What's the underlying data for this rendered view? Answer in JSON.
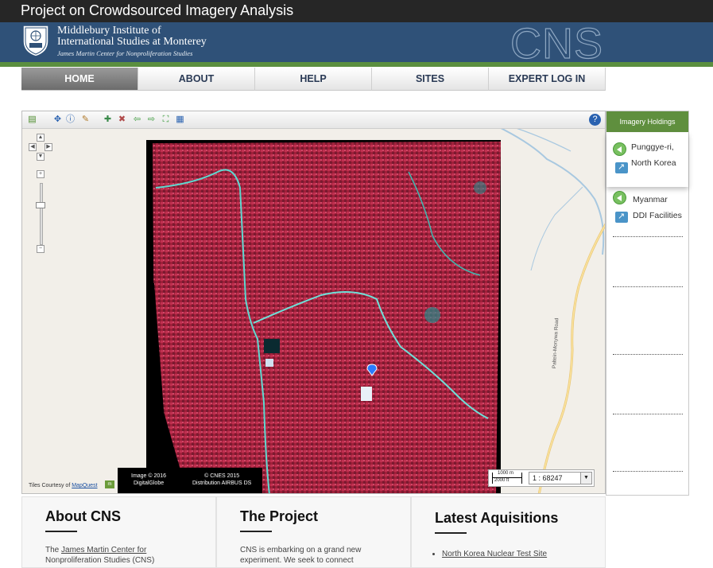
{
  "site_title": "Project on Crowdsourced Imagery Analysis",
  "header": {
    "institute_line1": "Middlebury Institute of",
    "institute_line2": "International Studies at Monterey",
    "institute_line3": "James Martin Center for Nonproliferation Studies",
    "logo_text": "CNS"
  },
  "nav": {
    "items": [
      {
        "label": "HOME",
        "active": true
      },
      {
        "label": "ABOUT",
        "active": false
      },
      {
        "label": "HELP",
        "active": false
      },
      {
        "label": "SITES",
        "active": false
      },
      {
        "label": "EXPERT LOG IN",
        "active": false
      }
    ]
  },
  "map": {
    "tiles_credit": "Tiles Courtesy of",
    "tiles_provider": "MapQuest",
    "image_credit_1": "Image © 2016",
    "image_credit_2": "DigitalGlobe",
    "image_credit_3": "© CNES 2015",
    "image_credit_4": "Distribution AIRBUS DS",
    "scale_m": "1000 m",
    "scale_ft": "2000 ft",
    "scale_value": "1 : 68247",
    "road_label": "Paltein-Monywa Road"
  },
  "side_panel": {
    "title": "Imagery Holdings",
    "holdings": [
      {
        "line1": "Punggye-ri,",
        "line2": "North Korea"
      },
      {
        "line1": "Myanmar",
        "line2": "DDI Facilities"
      }
    ]
  },
  "cards": [
    {
      "title": "About CNS",
      "text_pre": "The ",
      "link": "James Martin Center for",
      "text_post": "Nonproliferation Studies (CNS)"
    },
    {
      "title": "The Project",
      "text": "CNS is embarking on a grand new experiment. We seek to connect"
    },
    {
      "title": "Latest Aquisitions",
      "items": [
        "North Korea Nuclear Test Site"
      ]
    }
  ],
  "colors": {
    "header_blue": "#2f5178",
    "accent_green": "#5b8f3f",
    "title_bar": "#262626"
  }
}
